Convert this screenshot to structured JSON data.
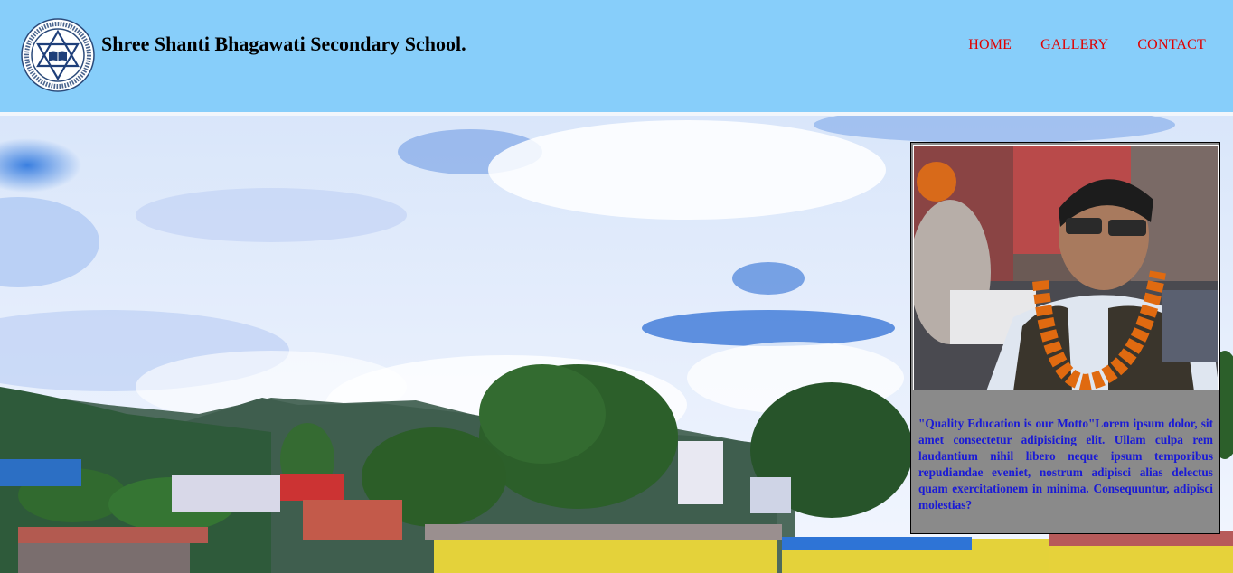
{
  "header": {
    "school_name": "Shree Shanti Bhagawati Secondary School.",
    "logo": {
      "icon": "school-emblem-logo",
      "ring_text_top": "SHREE SHANTI BHAGAWATI SECONDARY SCHOOL",
      "ring_text_bottom": "LETANG-4, MORANG",
      "year_left": "ESD.",
      "year_right": "2006"
    },
    "background_color": "#87cefa"
  },
  "nav": {
    "items": [
      {
        "label": "HOME"
      },
      {
        "label": "GALLERY"
      },
      {
        "label": "CONTACT"
      }
    ],
    "color": "#e00000"
  },
  "hero": {
    "description_icon": "school-campus-landscape-photo"
  },
  "card": {
    "photo_icon": "principal-portrait-photo",
    "motto": "\"Quality Education is our Motto\"Lorem ipsum dolor, sit amet consectetur adipisicing elit. Ullam culpa rem laudantium nihil libero neque ipsum temporibus repudiandae eveniet, nostrum adipisci alias delectus quam exercitationem in minima. Consequuntur, adipisci molestias?",
    "text_color": "#1a1ad6",
    "background_color": "#8a8a8a"
  }
}
